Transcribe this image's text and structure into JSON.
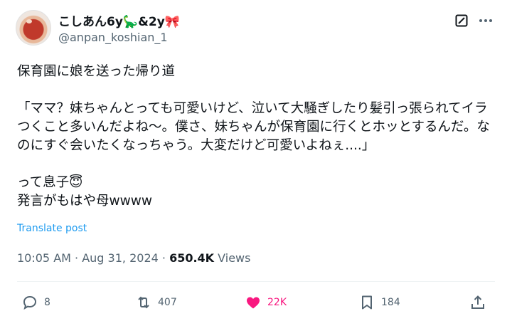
{
  "author": {
    "display_name": "こしあん6y🦕&2y🎀",
    "handle": "@anpan_koshian_1"
  },
  "icons": {
    "grok": "grok-icon",
    "more": "more-icon",
    "reply": "reply-icon",
    "repost": "repost-icon",
    "like": "heart-icon",
    "bookmark": "bookmark-icon",
    "share": "share-icon"
  },
  "tweet": {
    "text": "保育園に娘を送った帰り道\n\n「ママ？妹ちゃんとっても可愛いけど、泣いて大騒ぎしたり髪引っ張られてイラつくこと多いんだよね〜。僕さ、妹ちゃんが保育園に行くとホッとするんだ。なのにすぐ会いたくなっちゃう。大変だけど可愛いよねぇ....」\n\nって息子😇\n発言がもはや母wwww",
    "translate_label": "Translate post"
  },
  "meta": {
    "time": "10:05 AM",
    "date": "Aug 31, 2024",
    "views_count": "650.4K",
    "views_label": "Views"
  },
  "actions": {
    "reply_count": "8",
    "repost_count": "407",
    "like_count": "22K",
    "bookmark_count": "184"
  },
  "colors": {
    "text": "#0f1419",
    "secondary": "#536471",
    "link": "#1d9bf0",
    "like": "#f91880"
  }
}
